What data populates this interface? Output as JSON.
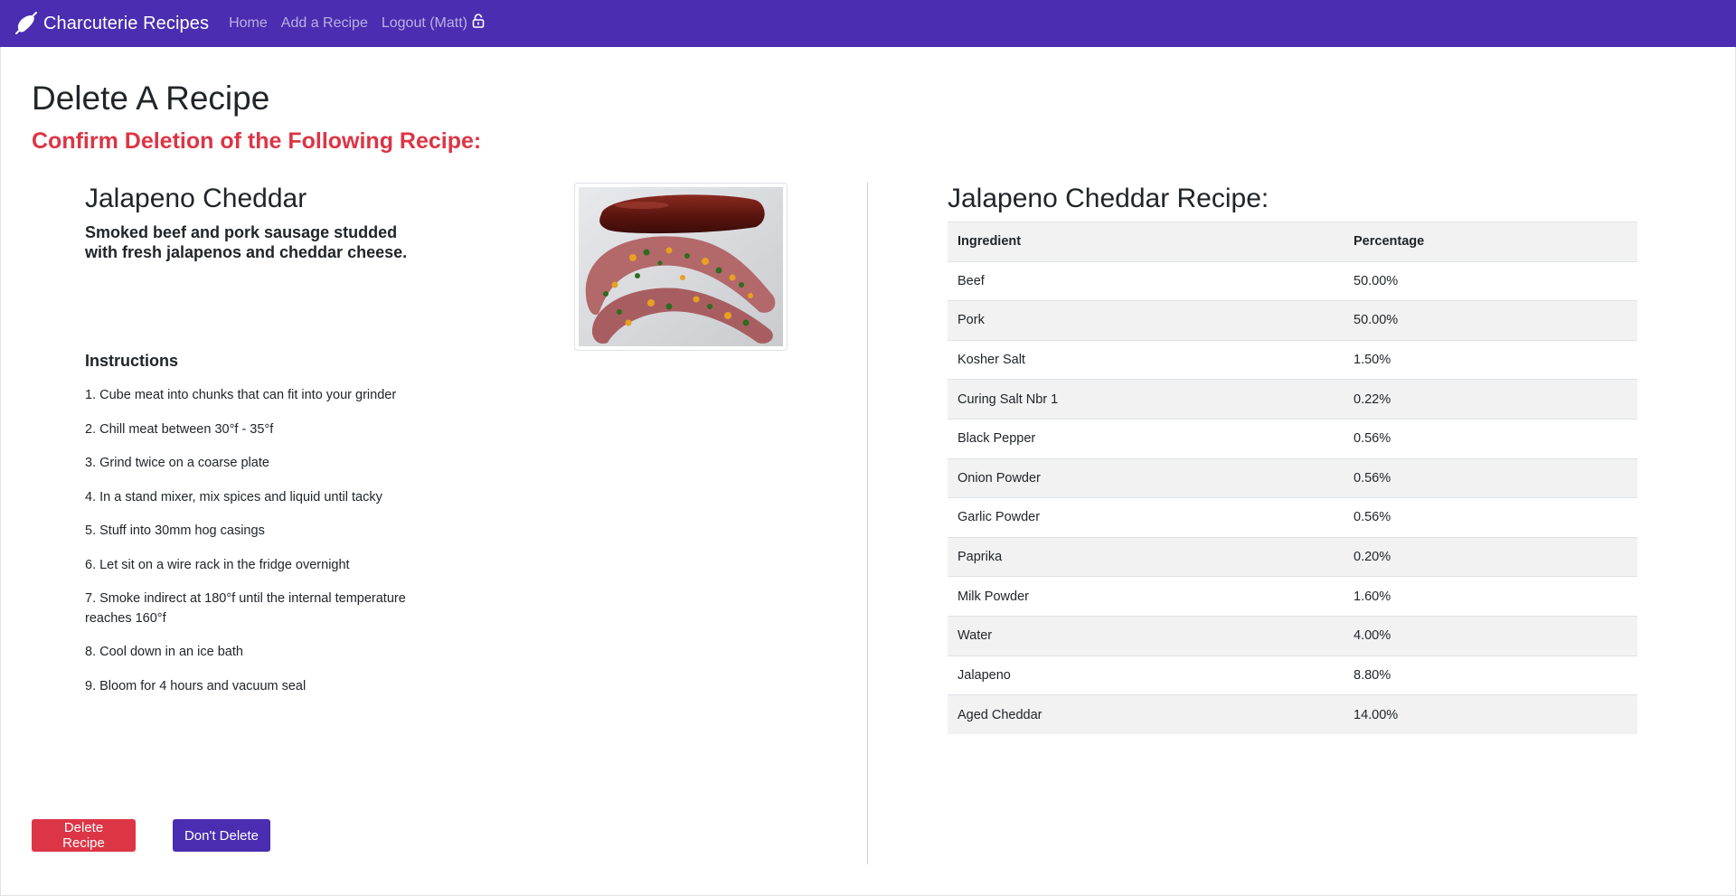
{
  "navbar": {
    "brand": "Charcuterie Recipes",
    "brand_icon": "sausage-icon",
    "links": [
      "Home",
      "Add a Recipe",
      "Logout (Matt)"
    ],
    "lock_icon": "unlock-icon",
    "color": "#4a2db0"
  },
  "page": {
    "title": "Delete A Recipe",
    "subtitle": "Confirm Deletion of the Following Recipe:",
    "subtitle_color": "#dc3545"
  },
  "recipe": {
    "name": "Jalapeno Cheddar",
    "description": "Smoked beef and pork sausage studded with fresh jalapenos and cheddar cheese.",
    "photo_icon": "sausage-photo",
    "instructions_heading": "Instructions",
    "instructions": [
      "1. Cube meat into chunks that can fit into your grinder",
      "2. Chill meat between 30°f - 35°f",
      "3. Grind twice on a coarse plate",
      "4. In a stand mixer, mix spices and liquid until tacky",
      "5. Stuff into 30mm hog casings",
      "6. Let sit on a wire rack in the fridge overnight",
      "7. Smoke indirect at 180°f until the internal temperature reaches 160°f",
      "8. Cool down in an ice bath",
      "9. Bloom for 4 hours and vacuum seal"
    ]
  },
  "table": {
    "heading": "Jalapeno Cheddar Recipe:",
    "columns": [
      "Ingredient",
      "Percentage"
    ],
    "rows": [
      [
        "Beef",
        "50.00%"
      ],
      [
        "Pork",
        "50.00%"
      ],
      [
        "Kosher Salt",
        "1.50%"
      ],
      [
        "Curing Salt Nbr 1",
        "0.22%"
      ],
      [
        "Black Pepper",
        "0.56%"
      ],
      [
        "Onion Powder",
        "0.56%"
      ],
      [
        "Garlic Powder",
        "0.56%"
      ],
      [
        "Paprika",
        "0.20%"
      ],
      [
        "Milk Powder",
        "1.60%"
      ],
      [
        "Water",
        "4.00%"
      ],
      [
        "Jalapeno",
        "8.80%"
      ],
      [
        "Aged Cheddar",
        "14.00%"
      ]
    ]
  },
  "buttons": {
    "delete": "Delete Recipe",
    "cancel": "Don't Delete",
    "delete_color": "#dc3545",
    "cancel_color": "#4a2db0"
  }
}
